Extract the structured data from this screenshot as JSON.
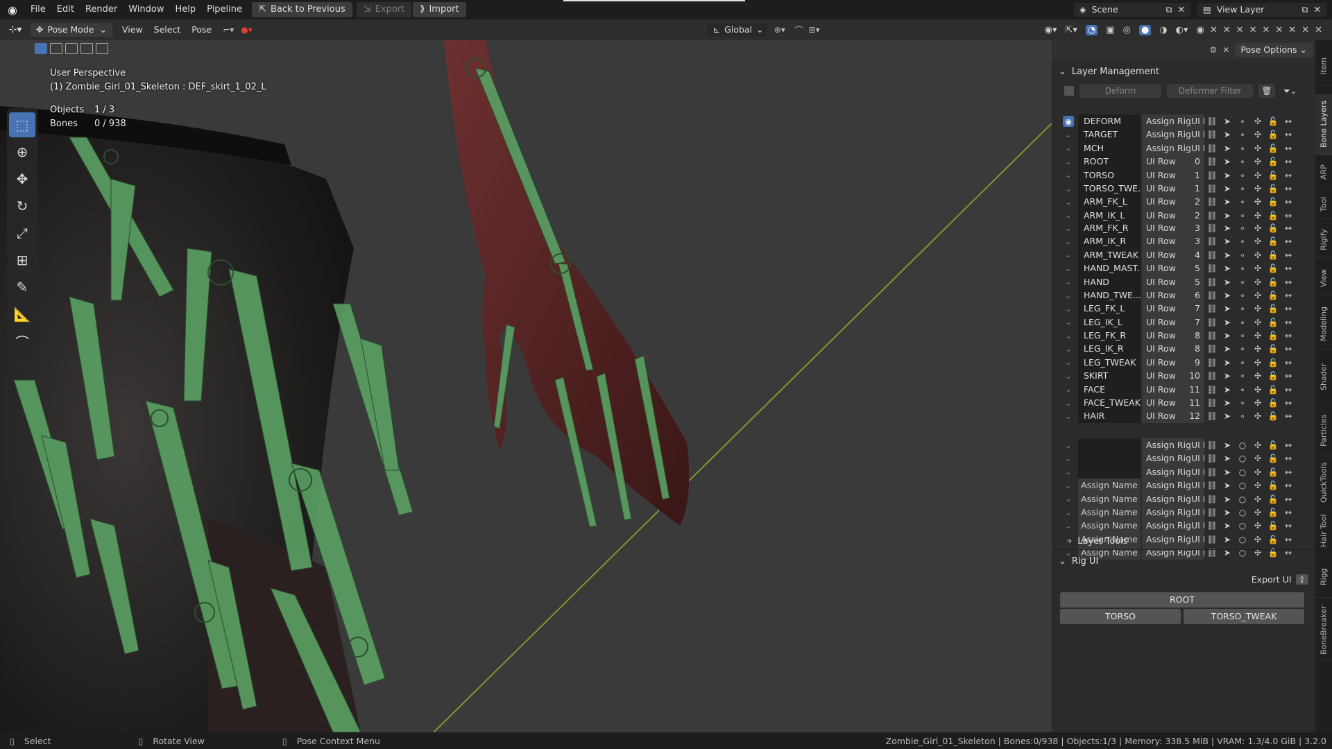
{
  "menubar": {
    "items": [
      "File",
      "Edit",
      "Render",
      "Window",
      "Help",
      "Pipeline"
    ],
    "back_label": "Back to Previous",
    "export_label": "Export",
    "import_label": "Import",
    "scene_label": "Scene",
    "view_layer_label": "View Layer"
  },
  "toolheader": {
    "mode": "Pose Mode",
    "menus": [
      "View",
      "Select",
      "Pose"
    ],
    "orientation": "Global",
    "pose_options": "Pose Options"
  },
  "viewport": {
    "perspective": "User Perspective",
    "active_object": "(1) Zombie_Girl_01_Skeleton : DEF_skirt_1_02_L",
    "objects_label": "Objects",
    "objects_value": "1 / 3",
    "bones_label": "Bones",
    "bones_value": "0 / 938"
  },
  "panel": {
    "layer_management": "Layer Management",
    "deform_btn": "Deform",
    "filter_btn": "Deformer Filter",
    "layers": [
      {
        "name": "DEFORM",
        "row": "Assign RigUI R...",
        "num": "",
        "visible": true
      },
      {
        "name": "TARGET",
        "row": "Assign RigUI R...",
        "num": "",
        "visible": false
      },
      {
        "name": "MCH",
        "row": "Assign RigUI R...",
        "num": "",
        "visible": false
      },
      {
        "name": "ROOT",
        "row": "UI Row",
        "num": "0",
        "visible": false
      },
      {
        "name": "TORSO",
        "row": "UI Row",
        "num": "1",
        "visible": false
      },
      {
        "name": "TORSO_TWE...",
        "row": "UI Row",
        "num": "1",
        "visible": false
      },
      {
        "name": "ARM_FK_L",
        "row": "UI Row",
        "num": "2",
        "visible": false
      },
      {
        "name": "ARM_IK_L",
        "row": "UI Row",
        "num": "2",
        "visible": false
      },
      {
        "name": "ARM_FK_R",
        "row": "UI Row",
        "num": "3",
        "visible": false
      },
      {
        "name": "ARM_IK_R",
        "row": "UI Row",
        "num": "3",
        "visible": false
      },
      {
        "name": "ARM_TWEAK",
        "row": "UI Row",
        "num": "4",
        "visible": false
      },
      {
        "name": "HAND_MAST...",
        "row": "UI Row",
        "num": "5",
        "visible": false
      },
      {
        "name": "HAND",
        "row": "UI Row",
        "num": "5",
        "visible": false
      },
      {
        "name": "HAND_TWE...",
        "row": "UI Row",
        "num": "6",
        "visible": false
      },
      {
        "name": "LEG_FK_L",
        "row": "UI Row",
        "num": "7",
        "visible": false
      },
      {
        "name": "LEG_IK_L",
        "row": "UI Row",
        "num": "7",
        "visible": false
      },
      {
        "name": "LEG_FK_R",
        "row": "UI Row",
        "num": "8",
        "visible": false
      },
      {
        "name": "LEG_IK_R",
        "row": "UI Row",
        "num": "8",
        "visible": false
      },
      {
        "name": "LEG_TWEAK",
        "row": "UI Row",
        "num": "9",
        "visible": false
      },
      {
        "name": "SKIRT",
        "row": "UI Row",
        "num": "10",
        "visible": false
      },
      {
        "name": "FACE",
        "row": "UI Row",
        "num": "11",
        "visible": false
      },
      {
        "name": "FACE_TWEAK",
        "row": "UI Row",
        "num": "11",
        "visible": false
      },
      {
        "name": "HAIR",
        "row": "UI Row",
        "num": "12",
        "visible": false
      },
      {
        "name": "",
        "row": "Assign RigUI R...",
        "num": "",
        "visible": false
      },
      {
        "name": "",
        "row": "Assign RigUI R...",
        "num": "",
        "visible": false
      },
      {
        "name": "",
        "row": "Assign RigUI R...",
        "num": "",
        "visible": false
      },
      {
        "name": "Assign Name",
        "row": "Assign RigUI R...",
        "num": "",
        "visible": false
      },
      {
        "name": "Assign Name",
        "row": "Assign RigUI R...",
        "num": "",
        "visible": false
      },
      {
        "name": "Assign Name",
        "row": "Assign RigUI R...",
        "num": "",
        "visible": false
      },
      {
        "name": "Assign Name",
        "row": "Assign RigUI R...",
        "num": "",
        "visible": false
      },
      {
        "name": "Assign Name",
        "row": "Assign RigUI R...",
        "num": "",
        "visible": false
      },
      {
        "name": "Assign Name",
        "row": "Assign RigUI R...",
        "num": "",
        "visible": false
      }
    ],
    "layer_tools": "Layer Tools",
    "rig_ui": "Rig UI",
    "export_ui": "Export UI",
    "root_btn": "ROOT",
    "torso_btn": "TORSO",
    "torso_tweak_btn": "TORSO_TWEAK"
  },
  "tabs": [
    "Item",
    "Bone Layers",
    "ARP",
    "Tool",
    "Rigify",
    "View",
    "Modeling",
    "Shader",
    "Particles",
    "QuickTools",
    "Hair Tool",
    "Rigg",
    "BoneBreaker"
  ],
  "statusbar": {
    "select": "Select",
    "rotate": "Rotate View",
    "context": "Pose Context Menu",
    "info": "Zombie_Girl_01_Skeleton | Bones:0/938 | Objects:1/3 | Memory: 338.5 MiB | VRAM: 1.3/4.0 GiB | 3.2.0"
  },
  "colors": {
    "accent": "#4772b3",
    "bone": "#5a9e62"
  }
}
